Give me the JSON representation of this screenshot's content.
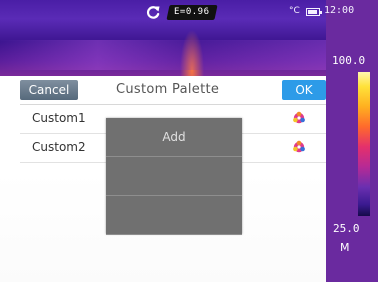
{
  "status_bar": {
    "emissivity": "E=0.96",
    "unit": "°C",
    "time": "12:00",
    "icons": [
      "refresh-icon",
      "battery-icon"
    ]
  },
  "scale": {
    "max": "100.0",
    "min": "25.0",
    "mode": "M"
  },
  "dialog": {
    "title": "Custom Palette",
    "cancel_label": "Cancel",
    "ok_label": "OK",
    "items": [
      {
        "label": "Custom1",
        "icon": "palette-icon"
      },
      {
        "label": "Custom2",
        "icon": "palette-icon"
      }
    ]
  },
  "popup_menu": {
    "items": [
      {
        "label": "Add"
      },
      {
        "label": ""
      },
      {
        "label": ""
      }
    ]
  },
  "colors": {
    "ok_button": "#2d9be8",
    "cancel_button": "#5e7082",
    "popup_bg": "#6d6d6d",
    "thermal_bg": "#4a1ea6"
  }
}
